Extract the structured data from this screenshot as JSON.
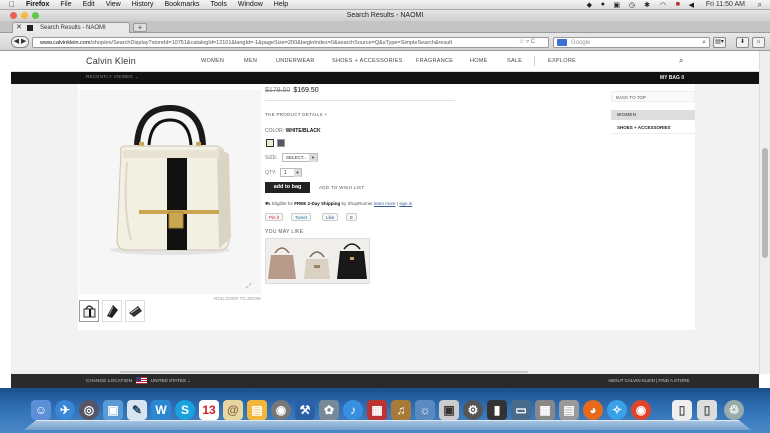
{
  "menubar": {
    "app": "Firefox",
    "items": [
      "File",
      "Edit",
      "View",
      "History",
      "Bookmarks",
      "Tools",
      "Window",
      "Help"
    ],
    "clock": "Fri 11:50 AM"
  },
  "window": {
    "title": "Search Results - NAOMI",
    "tab_title": "Search Results - NAOMI",
    "url_domain": "www.calvinklein.com",
    "url_rest": "/shop/en/SearchDisplay?storeId=10751&catalogId=12101&langId=-1&pageSize=200&beginIndex=0&searchSource=Q&sType=SimpleSearch&result",
    "search_engine": "Google"
  },
  "site": {
    "logo": "Calvin Klein",
    "nav": [
      "WOMEN",
      "MEN",
      "UNDERWEAR",
      "SHOES + ACCESSORIES",
      "FRAGRANCE",
      "HOME",
      "SALE",
      "EXPLORE"
    ],
    "recently_viewed": "RECENTLY VIEWED ⌄",
    "my_bag": "MY BAG",
    "bag_count": "0"
  },
  "product": {
    "old_price": "$179.50",
    "price": "$169.50",
    "details_link": "THE PRODUCT DETAILS +",
    "color_label": "COLOR:",
    "color_value": "WHITE/BLACK",
    "size_label": "SIZE:",
    "size_value": "SELECT...",
    "qty_label": "QTY:",
    "qty_value": "1",
    "add_to_bag": "add to bag",
    "add_to_wish": "ADD TO WISH LIST",
    "ship_prefix": "Eligible for",
    "ship_em": "FREE 2-Day Shipping",
    "ship_by": "by ShopRunner",
    "ship_learn": "learn more",
    "ship_sep": "|",
    "ship_signin": "sign in",
    "zoom_hint": "ROLLOVER TO ZOOM",
    "you_may_like": "YOU MAY LIKE",
    "social": {
      "pin": "Pin it",
      "tweet": "Tweet",
      "like": "Like",
      "like_count": "0"
    }
  },
  "sidebar": {
    "back_to_top": "BACK TO TOP",
    "items": [
      "WOMEN",
      "SHOES + ACCESSORIES"
    ]
  },
  "footer": {
    "change_location": "CHANGE LOCATION",
    "country": "UNITED STATES ⌄",
    "right": "ABOUT CALVIN KLEIN  |  FIND A STORE"
  }
}
